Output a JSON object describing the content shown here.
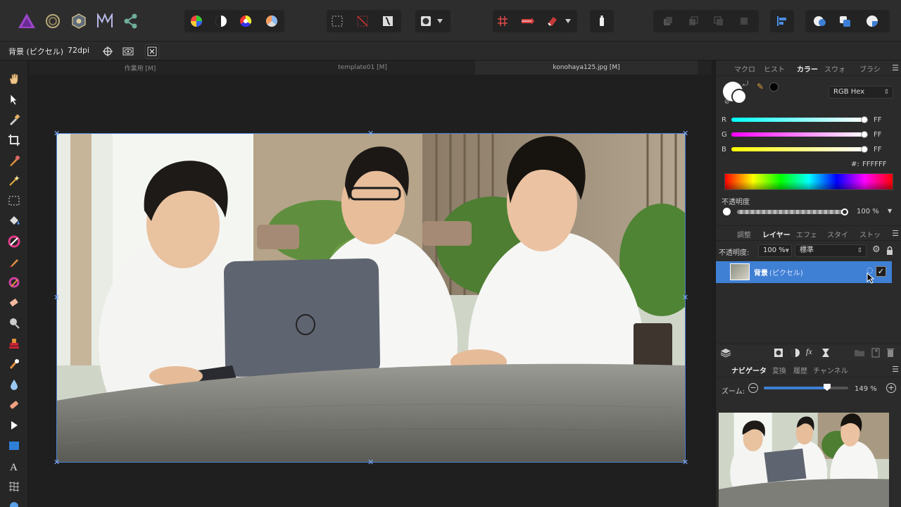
{
  "context": {
    "layer_name": "背景 (ピクセル)",
    "dpi": "72dpi"
  },
  "doc_tabs": [
    {
      "label": "作業用 [M]"
    },
    {
      "label": "template01 [M]"
    },
    {
      "label": "konohaya125.jpg [M]"
    }
  ],
  "color_panel": {
    "tabs": [
      "マクロ",
      "ヒスト",
      "カラー",
      "スウォ",
      "ブラシ"
    ],
    "mode": "RGB Hex",
    "channels": [
      {
        "name": "R",
        "value": "FF",
        "gradient": "#00ffff,#ffffff"
      },
      {
        "name": "G",
        "value": "FF",
        "gradient": "#ff00ff,#ffffff"
      },
      {
        "name": "B",
        "value": "FF",
        "gradient": "#ffff00,#ffffff"
      }
    ],
    "hex_label": "#:",
    "hex_value": "FFFFFF",
    "opacity_label": "不透明度",
    "opacity_value": "100 %"
  },
  "layers_panel": {
    "tabs": [
      "調整",
      "レイヤー",
      "エフェ",
      "スタイ",
      "ストッ"
    ],
    "opacity_label": "不透明度:",
    "opacity_value": "100 %",
    "blend_mode": "標準",
    "layers": [
      {
        "name": "背景",
        "suffix": "(ピクセル)",
        "visible": true
      }
    ]
  },
  "navigator_panel": {
    "tabs": [
      "ナビゲータ",
      "変換",
      "履歴",
      "チャンネル"
    ],
    "zoom_label": "ズーム:",
    "zoom_value": "149 %"
  },
  "colors": {
    "accent": "#3f7fd4",
    "selection": "#4a7fd6"
  }
}
